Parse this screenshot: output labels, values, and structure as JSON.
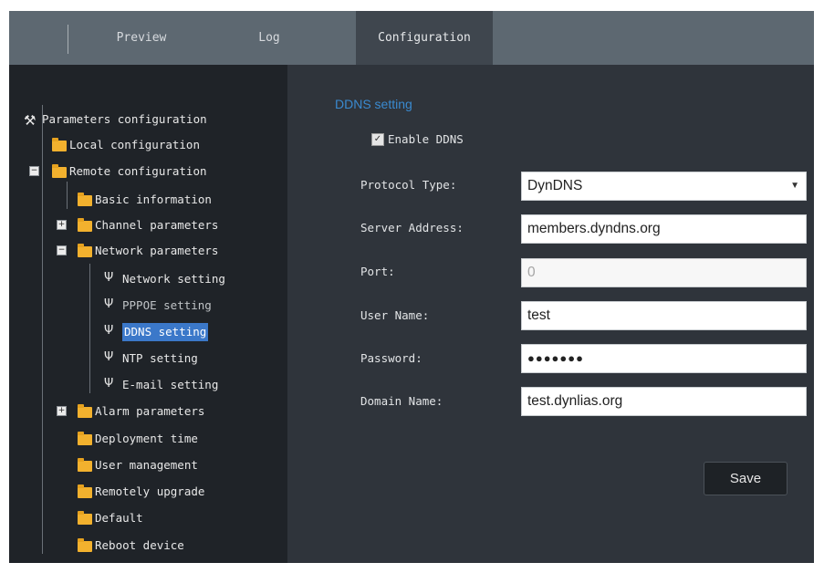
{
  "tabs": {
    "preview": "Preview",
    "log": "Log",
    "configuration": "Configuration"
  },
  "tree": {
    "root": "Parameters configuration",
    "local": "Local configuration",
    "remote": "Remote configuration",
    "basic": "Basic information",
    "channel": "Channel parameters",
    "network": "Network parameters",
    "network_setting": "Network setting",
    "pppoe_setting": "PPPOE setting",
    "ddns_setting": "DDNS setting",
    "ntp_setting": "NTP setting",
    "email_setting": "E-mail setting",
    "alarm": "Alarm parameters",
    "deployment": "Deployment time",
    "user": "User management",
    "upgrade": "Remotely upgrade",
    "default": "Default",
    "reboot": "Reboot device"
  },
  "form": {
    "section_title": "DDNS setting",
    "enable_label": "Enable DDNS",
    "enable_checked": true,
    "protocol_label": "Protocol Type:",
    "protocol_value": "DynDNS",
    "server_label": "Server Address:",
    "server_value": "members.dyndns.org",
    "port_label": "Port:",
    "port_value": "0",
    "username_label": "User Name:",
    "username_value": "test",
    "password_label": "Password:",
    "password_value": "●●●●●●●",
    "domain_label": "Domain Name:",
    "domain_value": "test.dynlias.org",
    "save_label": "Save"
  },
  "colors": {
    "accent": "#3a8ad0",
    "selected": "#3b78c9",
    "folder": "#f2b12e"
  },
  "icons": {
    "root": "tools-icon",
    "folder": "folder-icon",
    "leaf": "wrench-icon",
    "checkbox": "checkmark-icon",
    "dropdown": "chevron-down-icon"
  }
}
